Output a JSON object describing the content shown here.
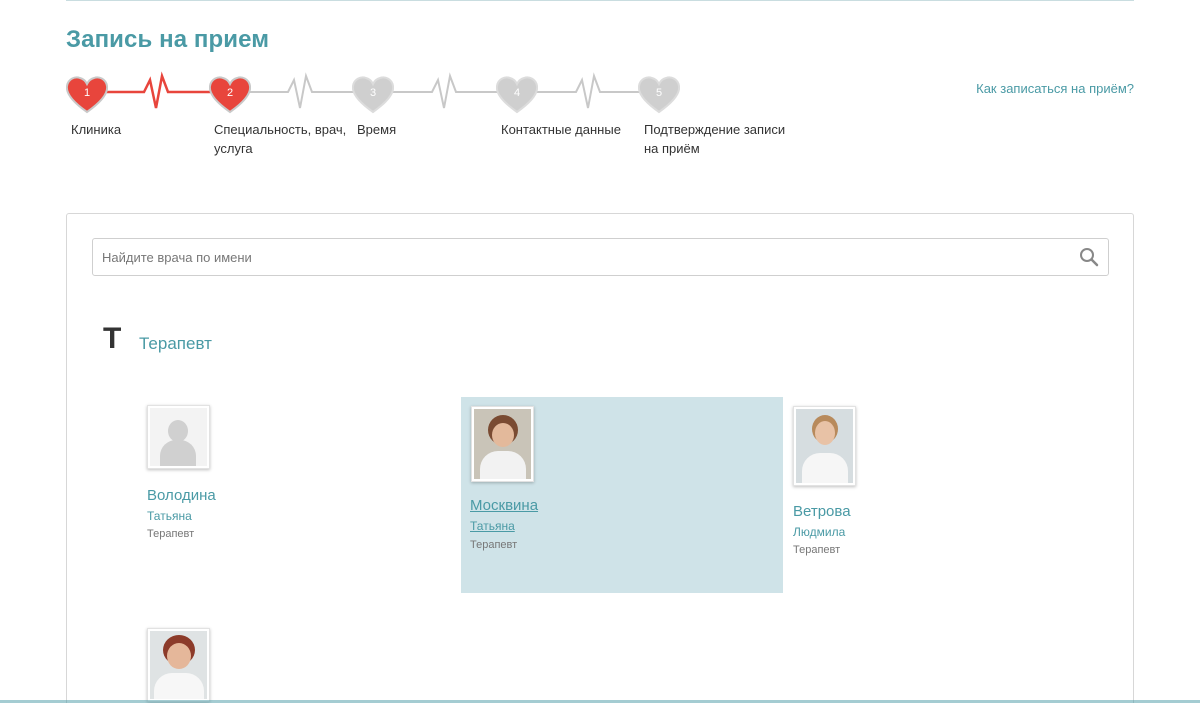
{
  "page": {
    "title": "Запись на прием",
    "help_link": "Как записаться на приём?"
  },
  "steps": [
    {
      "num": "1",
      "label": "Клиника",
      "state": "done"
    },
    {
      "num": "2",
      "label": "Специальность, врач, услуга",
      "state": "active"
    },
    {
      "num": "3",
      "label": "Время",
      "state": "pending"
    },
    {
      "num": "4",
      "label": "Контактные данные",
      "state": "pending"
    },
    {
      "num": "5",
      "label": "Подтверждение записи на приём",
      "state": "pending"
    }
  ],
  "colors": {
    "accent": "#4a9aa5",
    "step_done": "#e8453c",
    "step_pending": "#cfcfcf",
    "selected_bg": "#cfe3e8"
  },
  "search": {
    "placeholder": "Найдите врача по имени",
    "value": "",
    "icon": "search-icon"
  },
  "group": {
    "letter": "Т",
    "specialty": "Терапевт"
  },
  "doctors": [
    {
      "last_name": "Володина",
      "first_name": "Татьяна",
      "specialty": "Терапевт",
      "photo": "placeholder-avatar",
      "selected": false
    },
    {
      "last_name": "Москвина",
      "first_name": "Татьяна",
      "specialty": "Терапевт",
      "photo": "portrait",
      "selected": true
    },
    {
      "last_name": "Ветрова",
      "first_name": "Людмила",
      "specialty": "Терапевт",
      "photo": "portrait",
      "selected": false
    },
    {
      "last_name": "",
      "first_name": "",
      "specialty": "",
      "photo": "portrait",
      "selected": false
    }
  ]
}
